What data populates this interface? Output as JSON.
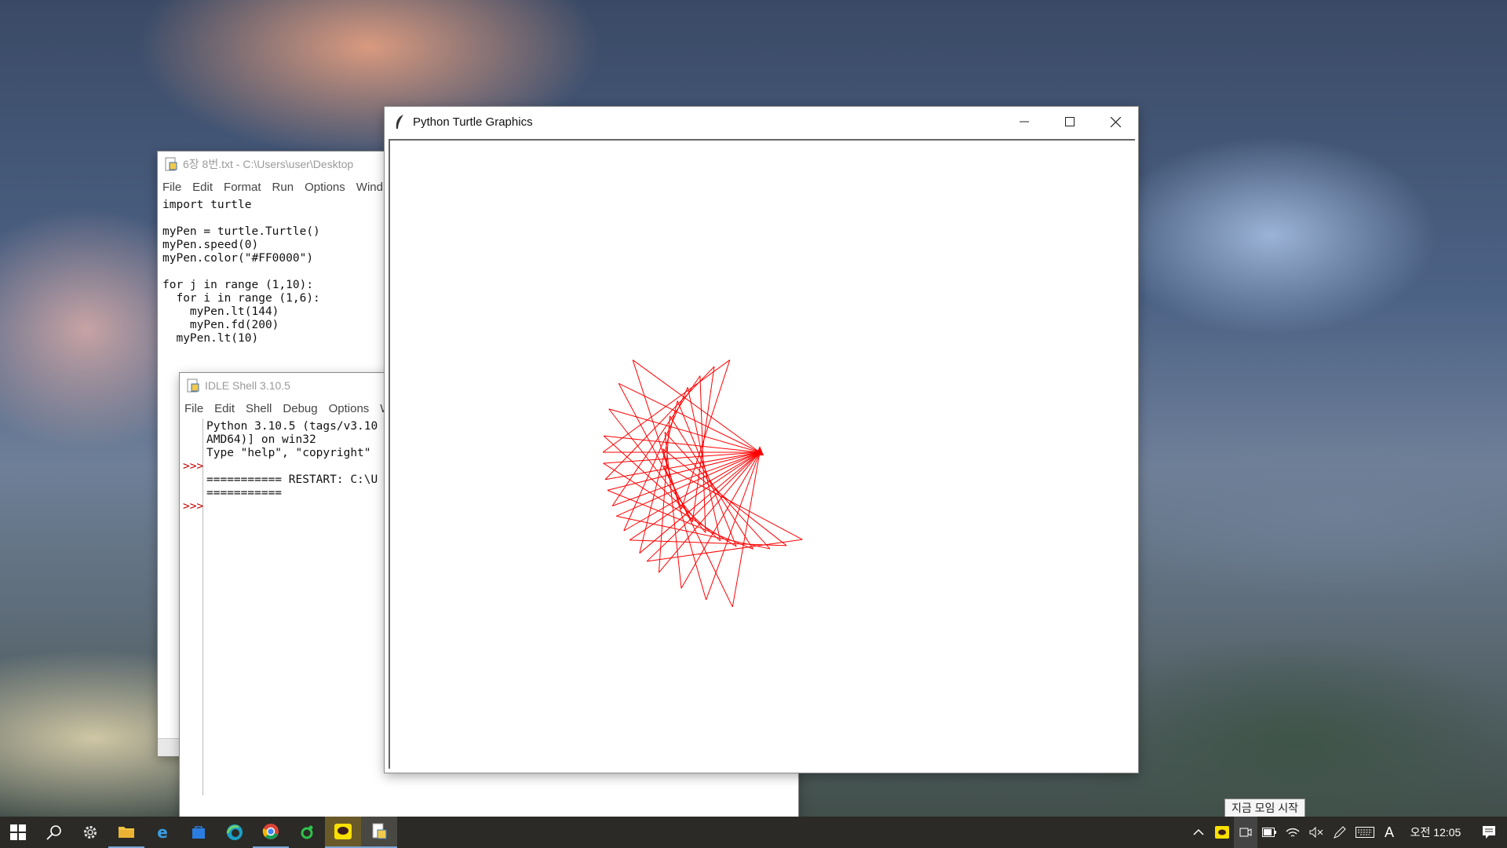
{
  "editor": {
    "title": "6장 8번.txt - C:\\Users\\user\\Desktop",
    "menu": [
      "File",
      "Edit",
      "Format",
      "Run",
      "Options",
      "Wind"
    ],
    "code": "import turtle\n\nmyPen = turtle.Turtle()\nmyPen.speed(0)\nmyPen.color(\"#FF0000\")\n\nfor j in range (1,10):\n  for i in range (1,6):\n    myPen.lt(144)\n    myPen.fd(200)\n  myPen.lt(10)"
  },
  "shell": {
    "title": "IDLE Shell 3.10.5",
    "menu": [
      "File",
      "Edit",
      "Shell",
      "Debug",
      "Options",
      "W"
    ],
    "gutter": "\n\n\n>>>\n\n\n>>>",
    "output": "Python 3.10.5 (tags/v3.10\nAMD64)] on win32\nType \"help\", \"copyright\"\n\n=========== RESTART: C:\\U\n==========="
  },
  "turtle": {
    "title": "Python Turtle Graphics",
    "pen_color": "#FF0000",
    "program": {
      "outer_loops": 9,
      "inner_loops": 5,
      "turn_angle": 144,
      "forward": 200,
      "outer_turn": 10
    }
  },
  "taskbar": {
    "tooltip": "지금 모임 시작",
    "input_indicator": "A",
    "clock": "오전 12:05",
    "apps": [
      "start-icon",
      "search-icon",
      "settings-icon",
      "file-explorer-icon",
      "internet-explorer-icon",
      "store-icon",
      "edge-icon",
      "chrome-icon",
      "green-app-icon",
      "kakaotalk-icon",
      "idle-icon"
    ]
  }
}
